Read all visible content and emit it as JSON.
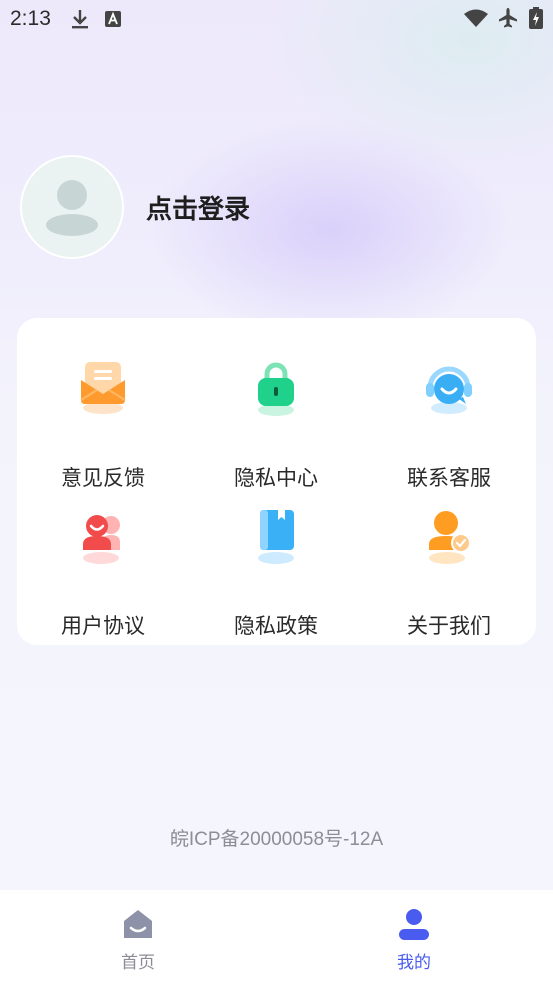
{
  "status_bar": {
    "time": "2:13"
  },
  "profile": {
    "login_text": "点击登录"
  },
  "menu": {
    "items": [
      {
        "label": "意见反馈",
        "icon": "feedback-mail-icon"
      },
      {
        "label": "隐私中心",
        "icon": "lock-icon"
      },
      {
        "label": "联系客服",
        "icon": "headset-icon"
      },
      {
        "label": "用户协议",
        "icon": "users-icon"
      },
      {
        "label": "隐私政策",
        "icon": "book-icon"
      },
      {
        "label": "关于我们",
        "icon": "user-check-icon"
      }
    ]
  },
  "footer": {
    "icp": "皖ICP备20000058号-12A"
  },
  "bottom_nav": {
    "items": [
      {
        "label": "首页",
        "icon": "home-icon",
        "active": false
      },
      {
        "label": "我的",
        "icon": "person-icon",
        "active": true
      }
    ]
  },
  "colors": {
    "accent": "#4a5cf0",
    "inactive": "#8c8c96"
  }
}
